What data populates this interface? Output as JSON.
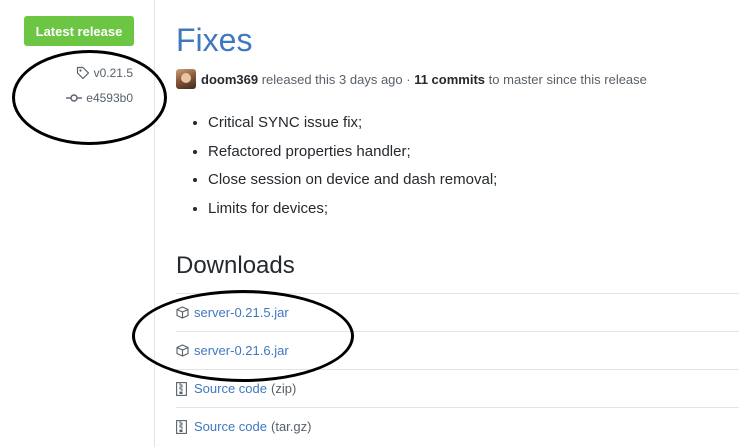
{
  "sidebar": {
    "badge": "Latest release",
    "tag": "v0.21.5",
    "commit": "e4593b0"
  },
  "release": {
    "title": "Fixes",
    "author": "doom369",
    "released_text": "released this 3 days ago ·",
    "commits": "11 commits",
    "since_text": "to master since this release",
    "notes": [
      "Critical SYNC issue fix;",
      "Refactored properties handler;",
      "Close session on device and dash removal;",
      "Limits for devices;"
    ]
  },
  "downloads": {
    "heading": "Downloads",
    "items": [
      {
        "label": "server-0.21.5.jar",
        "suffix": "",
        "icon": "package-icon"
      },
      {
        "label": "server-0.21.6.jar",
        "suffix": "",
        "icon": "package-icon"
      },
      {
        "label": "Source code",
        "suffix": "(zip)",
        "icon": "zip-icon"
      },
      {
        "label": "Source code",
        "suffix": "(tar.gz)",
        "icon": "zip-icon"
      }
    ]
  },
  "colors": {
    "badge_bg": "#6cc644",
    "link": "#4078c0",
    "muted": "#586069"
  }
}
